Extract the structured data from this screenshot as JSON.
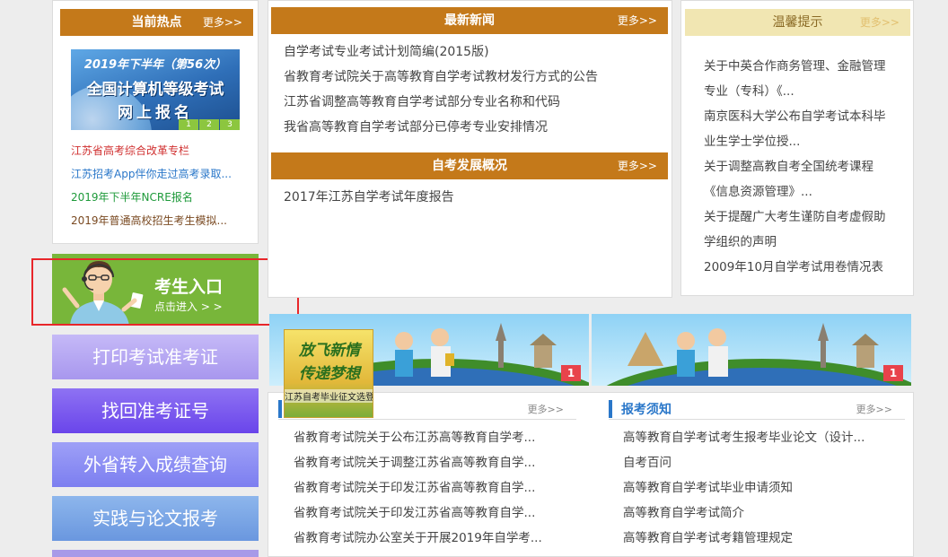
{
  "hot": {
    "title": "当前热点",
    "more": "更多>>",
    "banner_line1": "2019年下半年（第56次）",
    "banner_line2": "全国计算机等级考试",
    "banner_line3": "网上报名",
    "banner_dots": [
      "1",
      "2",
      "3"
    ],
    "links": [
      {
        "text": "江苏省高考综合改革专栏",
        "color": "#d03030"
      },
      {
        "text": "江苏招考App伴你走过高考录取...",
        "color": "#2a77c9"
      },
      {
        "text": "2019年下半年NCRE报名",
        "color": "#1e9a3a"
      },
      {
        "text": "2019年普通高校招生考生模拟...",
        "color": "#7a4a22"
      }
    ]
  },
  "news": {
    "title": "最新新闻",
    "more": "更多>>",
    "items": [
      "自学考试专业考试计划简编(2015版)",
      "省教育考试院关于高等教育自学考试教材发行方式的公告",
      "江苏省调整高等教育自学考试部分专业名称和代码",
      "我省高等教育自学考试部分已停考专业安排情况"
    ]
  },
  "dev": {
    "title": "自考发展概况",
    "more": "更多>>",
    "items": [
      "2017年江苏自学考试年度报告"
    ]
  },
  "tips": {
    "title": "温馨提示",
    "more": "更多>>",
    "items": [
      "关于中英合作商务管理、金融管理专业（专科）《...",
      "南京医科大学公布自学考试本科毕业生学士学位授...",
      "关于调整高教自考全国统考课程《信息资源管理》...",
      "关于提醒广大考生谨防自考虚假助学组织的声明",
      "2009年10月自学考试用卷情况表"
    ]
  },
  "entry": {
    "title": "考生入口",
    "sub": "点击进入 > >"
  },
  "buttons": [
    {
      "label": "打印考试准考证",
      "color": "#b7a8f2"
    },
    {
      "label": "找回准考证号",
      "color": "#7d5cf0"
    },
    {
      "label": "外省转入成绩查询",
      "color": "#8b8df5"
    },
    {
      "label": "实践与论文报考",
      "color": "#7aa6e6"
    }
  ],
  "slides": {
    "left_flag": "1",
    "right_flag": "1",
    "poster_line1": "放飞新情",
    "poster_line2": "传递梦想",
    "poster_caption": "江苏自考毕业征文选登"
  },
  "notices": {
    "more": "更多>>",
    "items": [
      "省教育考试院关于公布江苏高等教育自学考...",
      "省教育考试院关于调整江苏省高等教育自学...",
      "省教育考试院关于印发江苏省高等教育自学...",
      "省教育考试院关于印发江苏省高等教育自学...",
      "省教育考试院办公室关于开展2019年自学考..."
    ]
  },
  "guide": {
    "title": "报考须知",
    "more": "更多>>",
    "items": [
      "高等教育自学考试考生报考毕业论文（设计...",
      "自考百问",
      "高等教育自学考试毕业申请须知",
      "高等教育自学考试简介",
      "高等教育自学考试考籍管理规定"
    ]
  }
}
